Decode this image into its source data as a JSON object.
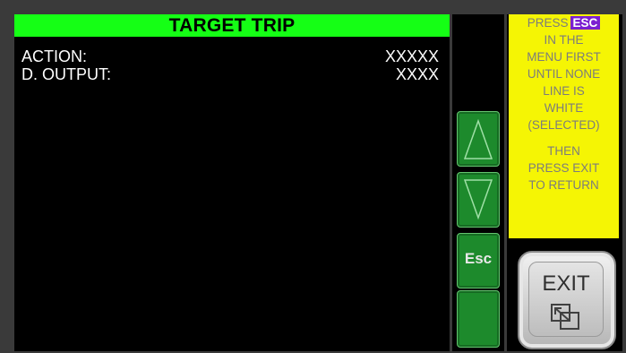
{
  "screen": {
    "title": "TARGET TRIP",
    "rows": [
      {
        "label": "ACTION:",
        "value": "XXXXX"
      },
      {
        "label": "D. OUTPUT:",
        "value": "XXXX"
      }
    ]
  },
  "buttons": {
    "up_icon": "triangle-up-icon",
    "down_icon": "triangle-down-icon",
    "esc_label": "Esc",
    "exit_label": "EXIT",
    "exit_icon": "return-arrow-icon"
  },
  "instructions": {
    "line1_prefix": "PRESS",
    "line1_badge": "ESC",
    "lines": [
      "IN THE",
      "MENU FIRST",
      "UNTIL NONE",
      "LINE IS",
      "WHITE",
      "(SELECTED)"
    ],
    "lines2": [
      "THEN",
      "PRESS EXIT",
      "TO RETURN"
    ]
  },
  "colors": {
    "title_bg": "#15ff15",
    "button_green": "#1d8a2c",
    "info_bg": "#f5f504",
    "esc_badge": "#7b1fd1"
  }
}
